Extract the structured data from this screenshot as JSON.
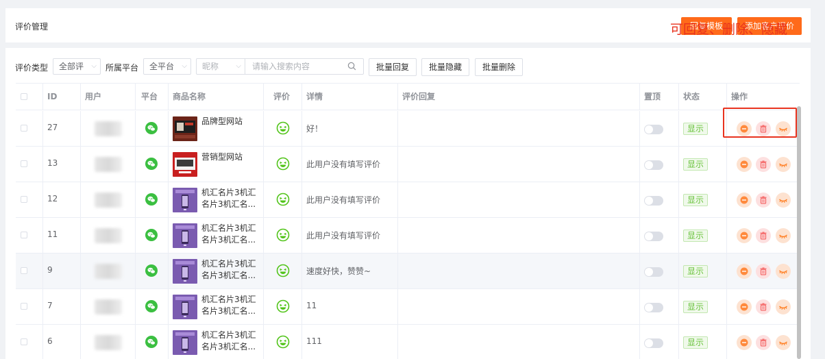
{
  "header": {
    "title": "评价管理",
    "reply_template_button": "回复模板",
    "add_review_button": "添加客户评价"
  },
  "filters": {
    "review_type_label": "评价类型",
    "review_type_value": "全部评",
    "platform_label": "所属平台",
    "platform_value": "全平台",
    "field_select_placeholder": "昵称",
    "search_placeholder": "请输入搜索内容",
    "batch_reply": "批量回复",
    "batch_hide": "批量隐藏",
    "batch_delete": "批量删除"
  },
  "annotation": "可回复、删除、隐藏",
  "table": {
    "columns": {
      "id": "ID",
      "user": "用户",
      "platform": "平台",
      "product": "商品名称",
      "rating": "评价",
      "detail": "详情",
      "reply": "评价回复",
      "pin": "置顶",
      "status": "状态",
      "actions": "操作"
    },
    "rows": [
      {
        "id": "27",
        "product": "品牌型网站",
        "detail": "好！",
        "status": "显示",
        "thumb": "dark"
      },
      {
        "id": "13",
        "product": "营销型网站",
        "detail": "此用户没有填写评价",
        "status": "显示",
        "thumb": "red"
      },
      {
        "id": "12",
        "product": "机汇名片3机汇名片3机汇名...",
        "detail": "此用户没有填写评价",
        "status": "显示",
        "thumb": "purple"
      },
      {
        "id": "11",
        "product": "机汇名片3机汇名片3机汇名...",
        "detail": "此用户没有填写评价",
        "status": "显示",
        "thumb": "purple"
      },
      {
        "id": "9",
        "product": "机汇名片3机汇名片3机汇名...",
        "detail": "速度好快，赞赞~",
        "status": "显示",
        "thumb": "purple"
      },
      {
        "id": "7",
        "product": "机汇名片3机汇名片3机汇名...",
        "detail": "11",
        "status": "显示",
        "thumb": "purple"
      },
      {
        "id": "6",
        "product": "机汇名片3机汇名片3机汇名...",
        "detail": "111",
        "status": "显示",
        "thumb": "purple"
      }
    ]
  },
  "colors": {
    "accent": "#ff6a1a",
    "wechat": "#3bbf41",
    "status_green": "#67c23a",
    "annotation_red": "#e8321e"
  },
  "icons": {
    "platform": "wechat-icon",
    "rating": "smile-icon",
    "reply": "comment-icon",
    "delete": "trash-icon",
    "hide": "eye-closed-icon"
  }
}
